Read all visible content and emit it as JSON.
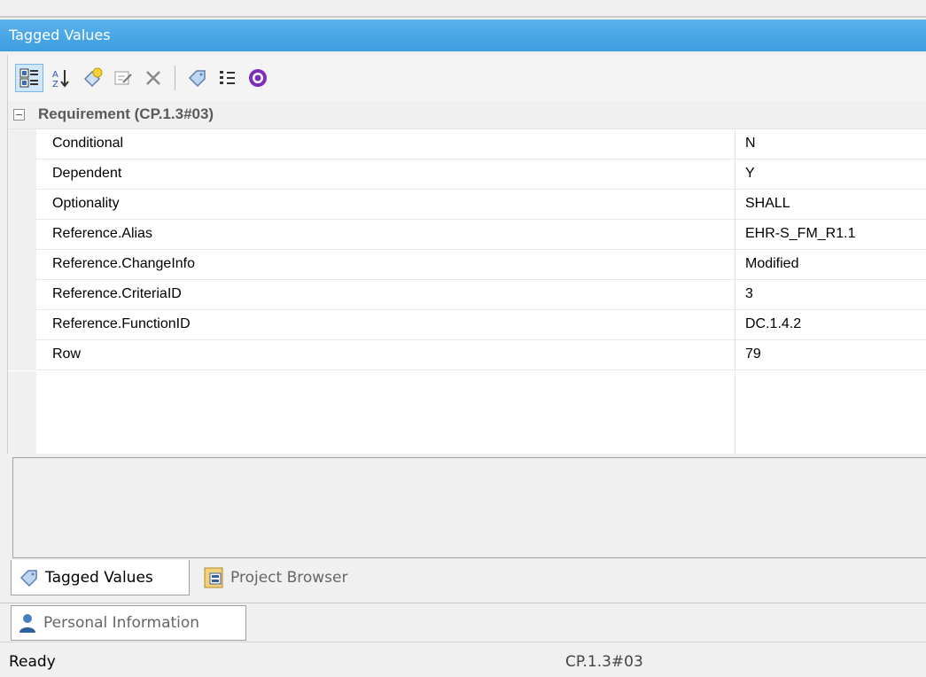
{
  "window": {
    "title": "Tagged Values"
  },
  "toolbar": {
    "icons": [
      "categorized-view-icon",
      "sort-alphabetical-icon",
      "new-tag-icon",
      "edit-note-icon",
      "delete-icon",
      "tag-icon",
      "show-duplicates-icon",
      "help-icon"
    ]
  },
  "group": {
    "label": "Requirement (CP.1.3#03)"
  },
  "properties": [
    {
      "name": "Conditional",
      "value": "N"
    },
    {
      "name": "Dependent",
      "value": "Y"
    },
    {
      "name": "Optionality",
      "value": "SHALL"
    },
    {
      "name": "Reference.Alias",
      "value": "EHR-S_FM_R1.1"
    },
    {
      "name": "Reference.ChangeInfo",
      "value": "Modified"
    },
    {
      "name": "Reference.CriteriaID",
      "value": "3"
    },
    {
      "name": "Reference.FunctionID",
      "value": "DC.1.4.2"
    },
    {
      "name": "Row",
      "value": "79"
    }
  ],
  "tabs": [
    {
      "label": "Tagged Values",
      "icon": "tag-icon",
      "active": true
    },
    {
      "label": "Project Browser",
      "icon": "project-browser-icon",
      "active": false
    }
  ],
  "tabs_row2": [
    {
      "label": "Personal Information",
      "icon": "person-icon",
      "active": false
    }
  ],
  "status": {
    "left": "Ready",
    "middle": "CP.1.3#03"
  },
  "colors": {
    "titlebar": "#4aa8e8",
    "accent": "#7b2fb8"
  }
}
